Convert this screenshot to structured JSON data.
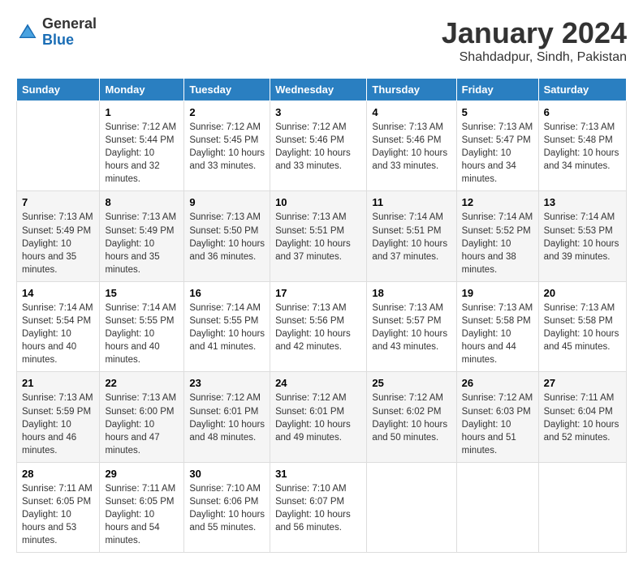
{
  "header": {
    "logo_general": "General",
    "logo_blue": "Blue",
    "month_title": "January 2024",
    "location": "Shahdadpur, Sindh, Pakistan"
  },
  "weekdays": [
    "Sunday",
    "Monday",
    "Tuesday",
    "Wednesday",
    "Thursday",
    "Friday",
    "Saturday"
  ],
  "weeks": [
    [
      {
        "day": "",
        "sunrise": "",
        "sunset": "",
        "daylight": ""
      },
      {
        "day": "1",
        "sunrise": "Sunrise: 7:12 AM",
        "sunset": "Sunset: 5:44 PM",
        "daylight": "Daylight: 10 hours and 32 minutes."
      },
      {
        "day": "2",
        "sunrise": "Sunrise: 7:12 AM",
        "sunset": "Sunset: 5:45 PM",
        "daylight": "Daylight: 10 hours and 33 minutes."
      },
      {
        "day": "3",
        "sunrise": "Sunrise: 7:12 AM",
        "sunset": "Sunset: 5:46 PM",
        "daylight": "Daylight: 10 hours and 33 minutes."
      },
      {
        "day": "4",
        "sunrise": "Sunrise: 7:13 AM",
        "sunset": "Sunset: 5:46 PM",
        "daylight": "Daylight: 10 hours and 33 minutes."
      },
      {
        "day": "5",
        "sunrise": "Sunrise: 7:13 AM",
        "sunset": "Sunset: 5:47 PM",
        "daylight": "Daylight: 10 hours and 34 minutes."
      },
      {
        "day": "6",
        "sunrise": "Sunrise: 7:13 AM",
        "sunset": "Sunset: 5:48 PM",
        "daylight": "Daylight: 10 hours and 34 minutes."
      }
    ],
    [
      {
        "day": "7",
        "sunrise": "Sunrise: 7:13 AM",
        "sunset": "Sunset: 5:49 PM",
        "daylight": "Daylight: 10 hours and 35 minutes."
      },
      {
        "day": "8",
        "sunrise": "Sunrise: 7:13 AM",
        "sunset": "Sunset: 5:49 PM",
        "daylight": "Daylight: 10 hours and 35 minutes."
      },
      {
        "day": "9",
        "sunrise": "Sunrise: 7:13 AM",
        "sunset": "Sunset: 5:50 PM",
        "daylight": "Daylight: 10 hours and 36 minutes."
      },
      {
        "day": "10",
        "sunrise": "Sunrise: 7:13 AM",
        "sunset": "Sunset: 5:51 PM",
        "daylight": "Daylight: 10 hours and 37 minutes."
      },
      {
        "day": "11",
        "sunrise": "Sunrise: 7:14 AM",
        "sunset": "Sunset: 5:51 PM",
        "daylight": "Daylight: 10 hours and 37 minutes."
      },
      {
        "day": "12",
        "sunrise": "Sunrise: 7:14 AM",
        "sunset": "Sunset: 5:52 PM",
        "daylight": "Daylight: 10 hours and 38 minutes."
      },
      {
        "day": "13",
        "sunrise": "Sunrise: 7:14 AM",
        "sunset": "Sunset: 5:53 PM",
        "daylight": "Daylight: 10 hours and 39 minutes."
      }
    ],
    [
      {
        "day": "14",
        "sunrise": "Sunrise: 7:14 AM",
        "sunset": "Sunset: 5:54 PM",
        "daylight": "Daylight: 10 hours and 40 minutes."
      },
      {
        "day": "15",
        "sunrise": "Sunrise: 7:14 AM",
        "sunset": "Sunset: 5:55 PM",
        "daylight": "Daylight: 10 hours and 40 minutes."
      },
      {
        "day": "16",
        "sunrise": "Sunrise: 7:14 AM",
        "sunset": "Sunset: 5:55 PM",
        "daylight": "Daylight: 10 hours and 41 minutes."
      },
      {
        "day": "17",
        "sunrise": "Sunrise: 7:13 AM",
        "sunset": "Sunset: 5:56 PM",
        "daylight": "Daylight: 10 hours and 42 minutes."
      },
      {
        "day": "18",
        "sunrise": "Sunrise: 7:13 AM",
        "sunset": "Sunset: 5:57 PM",
        "daylight": "Daylight: 10 hours and 43 minutes."
      },
      {
        "day": "19",
        "sunrise": "Sunrise: 7:13 AM",
        "sunset": "Sunset: 5:58 PM",
        "daylight": "Daylight: 10 hours and 44 minutes."
      },
      {
        "day": "20",
        "sunrise": "Sunrise: 7:13 AM",
        "sunset": "Sunset: 5:58 PM",
        "daylight": "Daylight: 10 hours and 45 minutes."
      }
    ],
    [
      {
        "day": "21",
        "sunrise": "Sunrise: 7:13 AM",
        "sunset": "Sunset: 5:59 PM",
        "daylight": "Daylight: 10 hours and 46 minutes."
      },
      {
        "day": "22",
        "sunrise": "Sunrise: 7:13 AM",
        "sunset": "Sunset: 6:00 PM",
        "daylight": "Daylight: 10 hours and 47 minutes."
      },
      {
        "day": "23",
        "sunrise": "Sunrise: 7:12 AM",
        "sunset": "Sunset: 6:01 PM",
        "daylight": "Daylight: 10 hours and 48 minutes."
      },
      {
        "day": "24",
        "sunrise": "Sunrise: 7:12 AM",
        "sunset": "Sunset: 6:01 PM",
        "daylight": "Daylight: 10 hours and 49 minutes."
      },
      {
        "day": "25",
        "sunrise": "Sunrise: 7:12 AM",
        "sunset": "Sunset: 6:02 PM",
        "daylight": "Daylight: 10 hours and 50 minutes."
      },
      {
        "day": "26",
        "sunrise": "Sunrise: 7:12 AM",
        "sunset": "Sunset: 6:03 PM",
        "daylight": "Daylight: 10 hours and 51 minutes."
      },
      {
        "day": "27",
        "sunrise": "Sunrise: 7:11 AM",
        "sunset": "Sunset: 6:04 PM",
        "daylight": "Daylight: 10 hours and 52 minutes."
      }
    ],
    [
      {
        "day": "28",
        "sunrise": "Sunrise: 7:11 AM",
        "sunset": "Sunset: 6:05 PM",
        "daylight": "Daylight: 10 hours and 53 minutes."
      },
      {
        "day": "29",
        "sunrise": "Sunrise: 7:11 AM",
        "sunset": "Sunset: 6:05 PM",
        "daylight": "Daylight: 10 hours and 54 minutes."
      },
      {
        "day": "30",
        "sunrise": "Sunrise: 7:10 AM",
        "sunset": "Sunset: 6:06 PM",
        "daylight": "Daylight: 10 hours and 55 minutes."
      },
      {
        "day": "31",
        "sunrise": "Sunrise: 7:10 AM",
        "sunset": "Sunset: 6:07 PM",
        "daylight": "Daylight: 10 hours and 56 minutes."
      },
      {
        "day": "",
        "sunrise": "",
        "sunset": "",
        "daylight": ""
      },
      {
        "day": "",
        "sunrise": "",
        "sunset": "",
        "daylight": ""
      },
      {
        "day": "",
        "sunrise": "",
        "sunset": "",
        "daylight": ""
      }
    ]
  ]
}
